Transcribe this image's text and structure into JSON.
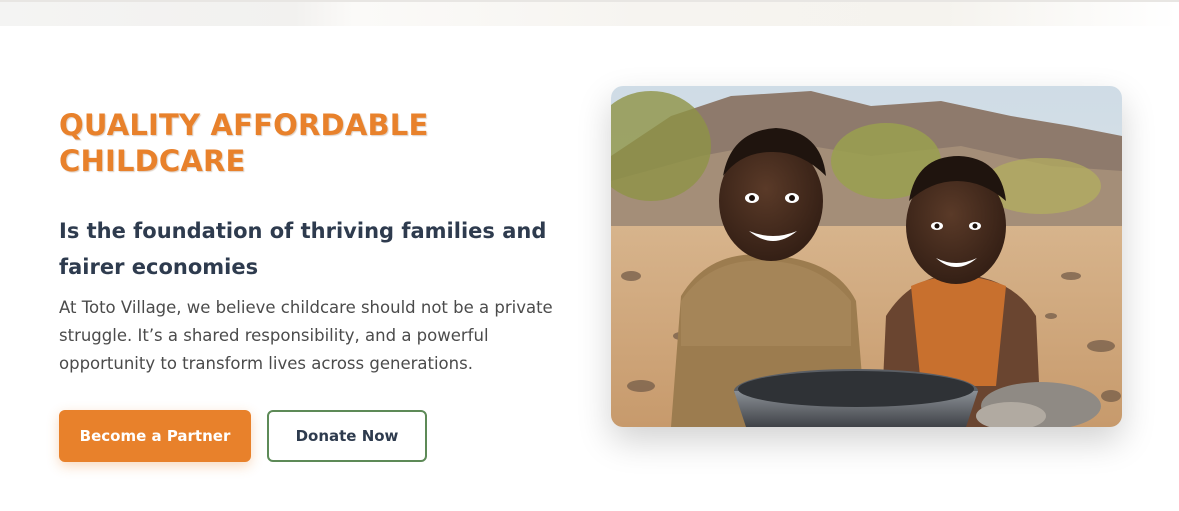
{
  "hero": {
    "eyebrow": "QUALITY AFFORDABLE CHILDCARE",
    "headline": "Is the foundation of thriving families and fairer economies",
    "body": "At Toto Village, we believe childcare should not be a private struggle. It’s a shared responsibility, and a powerful opportunity to transform lives across generations.",
    "primary_button": "Become a Partner",
    "secondary_button": "Donate Now"
  },
  "colors": {
    "accent_orange": "#e8812b",
    "heading_navy": "#2e3b4e",
    "body_gray": "#4b4b4b",
    "outline_green": "#5d8a57"
  },
  "image": {
    "subject": "two smiling children sitting in a dry landscape behind a metal bowl"
  }
}
